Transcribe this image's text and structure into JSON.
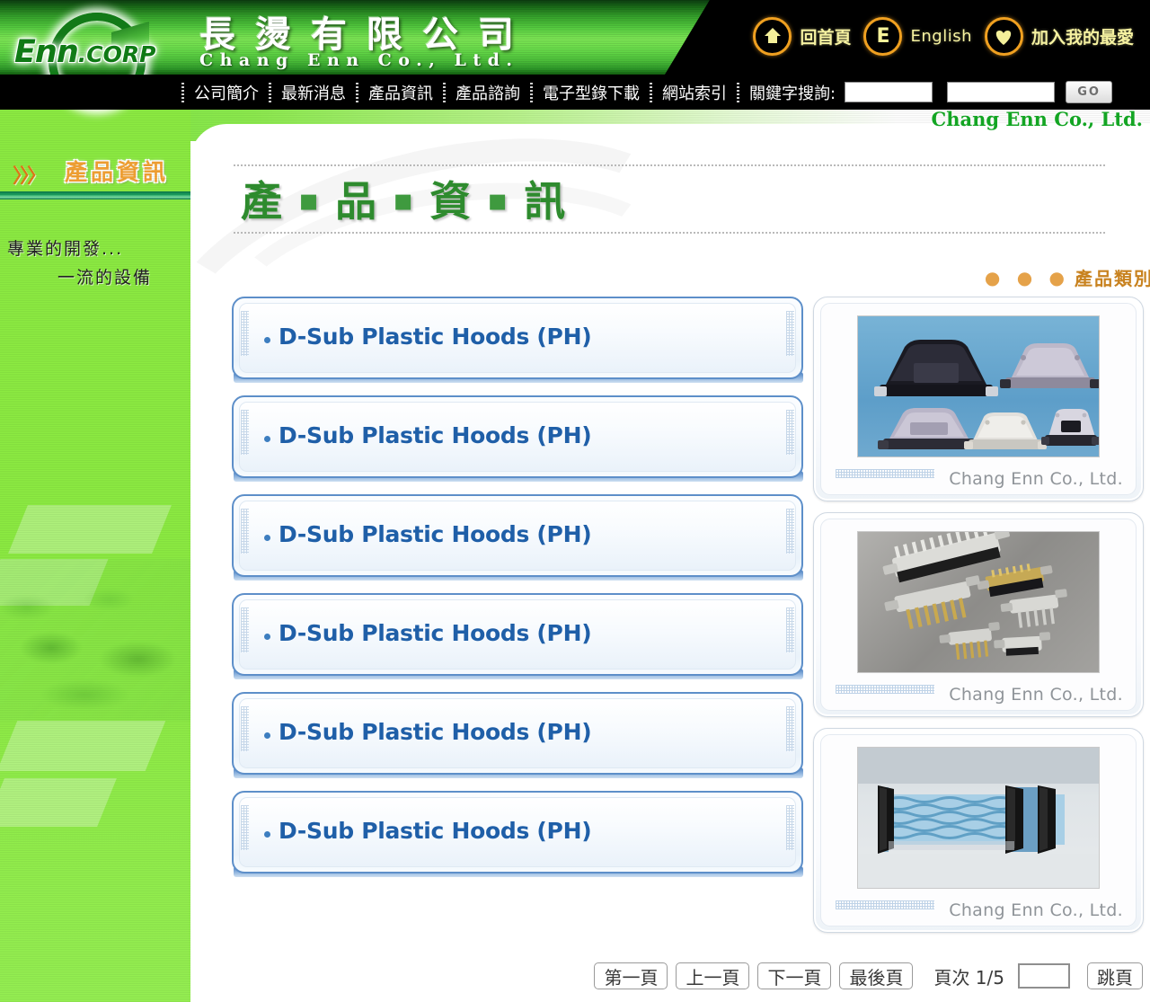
{
  "header": {
    "logo_text_main": "Enn",
    "logo_text_sub": ".CORP",
    "company_name_cn": "長燙有限公司",
    "company_name_en": "Chang Enn Co., Ltd.",
    "quicklinks": [
      {
        "icon": "home-icon",
        "label": "回首頁"
      },
      {
        "icon": "english-e-icon",
        "label": "English"
      },
      {
        "icon": "heart-icon",
        "label": "加入我的最愛"
      }
    ]
  },
  "nav": {
    "items": [
      "公司簡介",
      "最新消息",
      "產品資訊",
      "產品諮詢",
      "電子型錄下載",
      "網站索引"
    ],
    "search_label": "關鍵字搜詢:",
    "search_value_1": "",
    "search_value_2": "",
    "search_placeholder": "",
    "go_label": "GO"
  },
  "brandline": "Chang Enn Co., Ltd.",
  "sidebar": {
    "arrows": "〉〉〉",
    "title": "產品資訊",
    "slogan_line1": "專業的開發...",
    "slogan_line2": "一流的設備"
  },
  "main": {
    "page_title": "產 ‧ 品 ‧ 資 ‧ 訊",
    "page_title_chars": [
      "產",
      "品",
      "資",
      "訊"
    ],
    "category_dots": "● ● ●",
    "category_label": "產品類別",
    "products": [
      {
        "label": "D-Sub Plastic Hoods (PH)"
      },
      {
        "label": "D-Sub Plastic Hoods (PH)"
      },
      {
        "label": "D-Sub Plastic Hoods (PH)"
      },
      {
        "label": "D-Sub Plastic Hoods (PH)"
      },
      {
        "label": "D-Sub Plastic Hoods (PH)"
      },
      {
        "label": "D-Sub Plastic Hoods (PH)"
      }
    ],
    "image_cards": [
      {
        "alt": "D-Sub plastic hoods assortment on blue background",
        "brand": "Chang Enn Co., Ltd."
      },
      {
        "alt": "D-Sub metal connectors assortment on grey background",
        "brand": "Chang Enn Co., Ltd."
      },
      {
        "alt": "Blue flat ribbon cable with black connectors",
        "brand": "Chang Enn Co., Ltd."
      }
    ]
  },
  "pager": {
    "first": "第一頁",
    "prev": "上一頁",
    "next": "下一頁",
    "last": "最後頁",
    "page_info": "頁次 1/5",
    "page_input_value": "",
    "jump": "跳頁"
  },
  "colors": {
    "brand_green": "#8ceb42",
    "dark_green": "#13a523",
    "accent_orange": "#f3a233",
    "link_blue": "#1f5fa8",
    "nav_black": "#000000"
  }
}
